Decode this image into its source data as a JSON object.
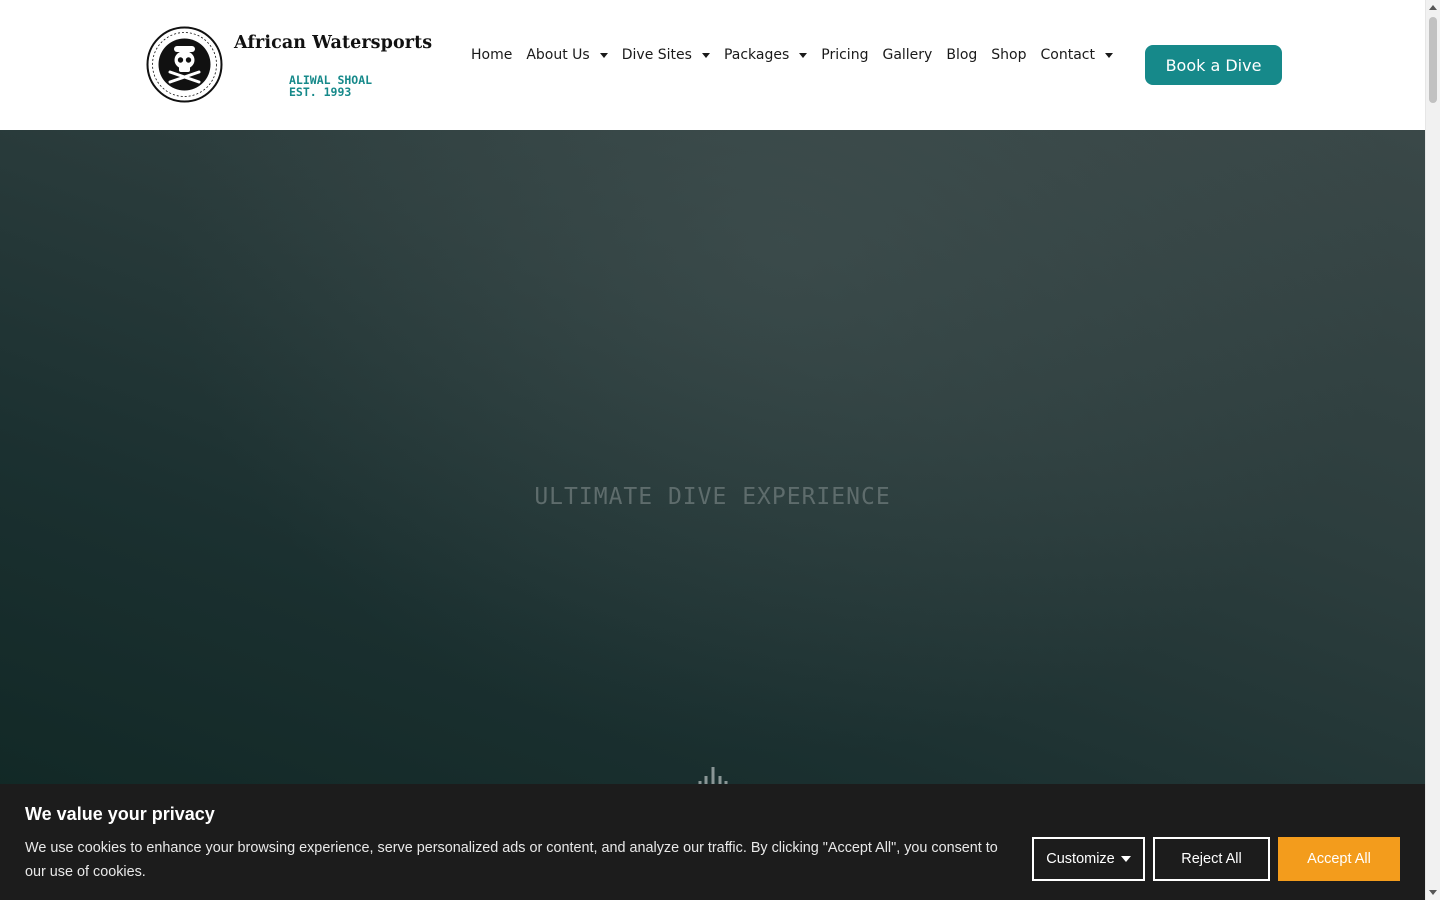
{
  "header": {
    "brand_title": "African Watersports",
    "brand_sub_line1": "ALIWAL SHOAL",
    "brand_sub_line2": "EST. 1993",
    "logo_text": "OCEAN PROTECTORS · African Watersports",
    "nav": [
      {
        "label": "Home",
        "has_dropdown": false
      },
      {
        "label": "About Us",
        "has_dropdown": true
      },
      {
        "label": "Dive Sites",
        "has_dropdown": true
      },
      {
        "label": "Packages",
        "has_dropdown": true
      },
      {
        "label": "Pricing",
        "has_dropdown": false
      },
      {
        "label": "Gallery",
        "has_dropdown": false
      },
      {
        "label": "Blog",
        "has_dropdown": false
      },
      {
        "label": "Shop",
        "has_dropdown": false
      },
      {
        "label": "Contact",
        "has_dropdown": true
      }
    ],
    "cta_label": "Book a Dive"
  },
  "hero": {
    "tagline": "ULTIMATE DIVE EXPERIENCE"
  },
  "cookie_banner": {
    "title": "We value your privacy",
    "text": "We use cookies to enhance your browsing experience, serve personalized ads or content, and analyze our traffic. By clicking \"Accept All\", you consent to our use of cookies.",
    "customize_label": "Customize",
    "reject_label": "Reject All",
    "accept_label": "Accept All"
  },
  "colors": {
    "accent": "#16898a",
    "accept": "#f39c1c",
    "banner_bg": "#1c1c1c",
    "hero_dark": "#0f2623"
  }
}
